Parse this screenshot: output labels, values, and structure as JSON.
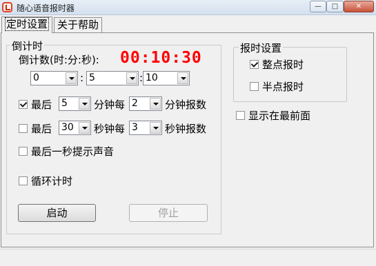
{
  "window": {
    "title": "随心语音报时器",
    "min_glyph": "—",
    "max_glyph": "□",
    "close_glyph": "✕"
  },
  "tabs": [
    {
      "label": "定时设置",
      "active": true
    },
    {
      "label": "关于帮助",
      "active": false
    }
  ],
  "countdown": {
    "group_title": "倒计时",
    "label": "倒计数(时:分:秒):",
    "display": "00:10:30",
    "display_color": "#ff0000",
    "hours": "0",
    "minutes": "5",
    "seconds": "10",
    "separator": ":",
    "rule1": {
      "checked": true,
      "prefix": "最后",
      "minutes": "5",
      "middle": "分钟每",
      "every": "2",
      "suffix": "分钟报数"
    },
    "rule2": {
      "checked": false,
      "prefix": "最后",
      "seconds": "30",
      "middle": "秒钟每",
      "every": "3",
      "suffix": "秒钟报数"
    },
    "last_second_sound": {
      "checked": false,
      "label": "最后一秒提示声音"
    },
    "loop": {
      "checked": false,
      "label": "循环计时"
    },
    "start_button": "启动",
    "stop_button": "停止"
  },
  "report": {
    "group_title": "报时设置",
    "on_hour": {
      "checked": true,
      "label": "整点报时"
    },
    "half_hour": {
      "checked": false,
      "label": "半点报时"
    }
  },
  "always_on_top": {
    "checked": false,
    "label": "显示在最前面"
  }
}
